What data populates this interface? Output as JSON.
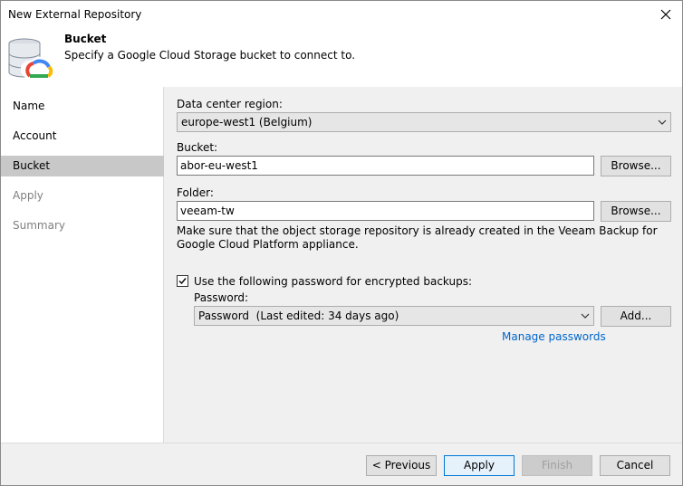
{
  "window": {
    "title": "New External Repository"
  },
  "header": {
    "title": "Bucket",
    "subtitle": "Specify a Google Cloud Storage bucket to connect to."
  },
  "sidebar": {
    "items": [
      {
        "label": "Name",
        "state": "done"
      },
      {
        "label": "Account",
        "state": "done"
      },
      {
        "label": "Bucket",
        "state": "active"
      },
      {
        "label": "Apply",
        "state": "disabled"
      },
      {
        "label": "Summary",
        "state": "disabled"
      }
    ]
  },
  "form": {
    "region_label": "Data center region:",
    "region_value": "europe-west1 (Belgium)",
    "bucket_label": "Bucket:",
    "bucket_value": "abor-eu-west1",
    "folder_label": "Folder:",
    "folder_value": "veeam-tw",
    "browse_label": "Browse...",
    "note": "Make sure that the object storage repository is already created in the Veeam Backup for Google Cloud Platform appliance.",
    "password_checkbox_label": "Use the following password for encrypted backups:",
    "password_checked": true,
    "password_label": "Password:",
    "password_value": "Password  (Last edited: 34 days ago)",
    "add_label": "Add...",
    "manage_passwords_label": "Manage passwords"
  },
  "footer": {
    "previous_label": "< Previous",
    "apply_label": "Apply",
    "finish_label": "Finish",
    "cancel_label": "Cancel"
  },
  "colors": {
    "active_nav": "#c8c8c8",
    "link": "#0066cc",
    "focus_border": "#0078d7"
  }
}
